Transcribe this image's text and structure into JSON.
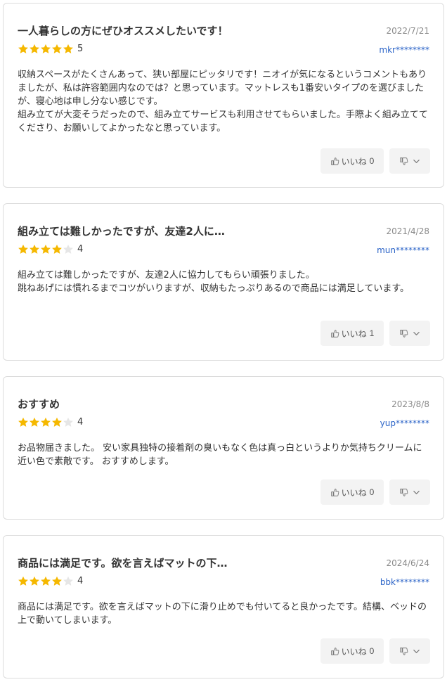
{
  "colors": {
    "star_filled": "#f5b800",
    "star_empty": "#e6e6e6",
    "reviewer": "#2a63c7",
    "date": "#8a8a8a",
    "button_bg": "#f3f3f3"
  },
  "reviews": [
    {
      "title": "一人暮らしの方にぜひオススメしたいです！",
      "date": "2022/7/21",
      "rating": 5,
      "rating_label": "5",
      "reviewer": "mkr********",
      "body": [
        "収納スペースがたくさんあって、狭い部屋にピッタリです！ニオイが気になるというコメントもありましたが、私は許容範囲内なのでは？と思っています。マットレスも1番安いタイプのを選びましたが、寝心地は申し分ない感じです。",
        "組み立てが大変そうだったので、組み立てサービスも利用させてもらいました。手際よく組み立ててくださり、お願いしてよかったなと思っています。"
      ],
      "like_label": "いいね",
      "like_count": "0"
    },
    {
      "title": "組み立ては難しかったですが、友達2人に…",
      "date": "2021/4/28",
      "rating": 4,
      "rating_label": "4",
      "reviewer": "mun********",
      "body": [
        "組み立ては難しかったですが、友達2人に協力してもらい頑張りました。",
        "跳ねあげには慣れるまでコツがいりますが、収納もたっぷりあるので商品には満足しています。"
      ],
      "like_label": "いいね",
      "like_count": "1"
    },
    {
      "title": "おすすめ",
      "date": "2023/8/8",
      "rating": 4,
      "rating_label": "4",
      "reviewer": "yup********",
      "body": [
        "お品物届きました。 安い家具独特の接着剤の臭いもなく色は真っ白というよりか気持ちクリームに近い色で素敵です。 おすすめします。"
      ],
      "like_label": "いいね",
      "like_count": "0"
    },
    {
      "title": "商品には満足です。欲を言えばマットの下…",
      "date": "2024/6/24",
      "rating": 4,
      "rating_label": "4",
      "reviewer": "bbk********",
      "body": [
        "商品には満足です。欲を言えばマットの下に滑り止めでも付いてると良かったです。結構、ベッドの上で動いてしまいます。"
      ],
      "like_label": "いいね",
      "like_count": "0"
    }
  ]
}
